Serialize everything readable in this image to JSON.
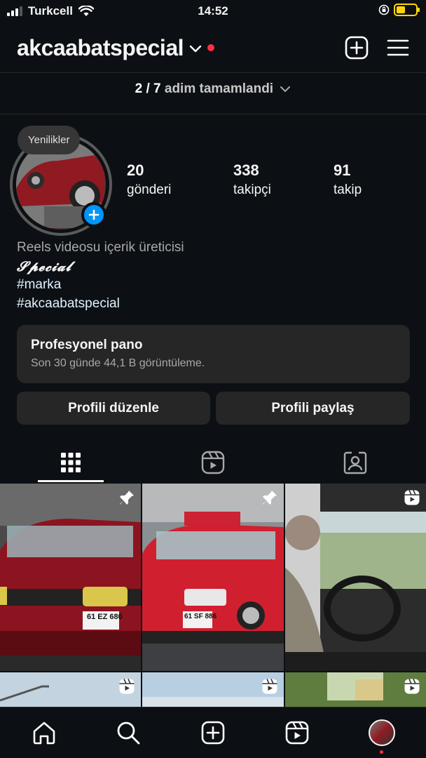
{
  "status_bar": {
    "carrier": "Turkcell",
    "time": "14:52"
  },
  "header": {
    "username": "akcaabatspecial"
  },
  "progress": {
    "count": "2 / 7",
    "label": "adim tamamlandi"
  },
  "profile": {
    "bubble": "Yenilikler",
    "stats": [
      {
        "value": "20",
        "label": "gönderi"
      },
      {
        "value": "338",
        "label": "takipçi"
      },
      {
        "value": "91",
        "label": "takip"
      }
    ],
    "bio": {
      "category": "Reels videosu içerik üreticisi",
      "name_line": "𝓢𝓹𝓮𝓬𝓲𝓪𝓵",
      "tags": [
        "#marka",
        "#akcaabatspecial"
      ]
    }
  },
  "dashboard": {
    "title": "Profesyonel pano",
    "subtitle": "Son 30 günde 44,1 B görüntüleme."
  },
  "buttons": {
    "edit": "Profili düzenle",
    "share": "Profili paylaş"
  },
  "grid": {
    "row1": [
      {
        "plate": "61 EZ 680",
        "icon": "pin-icon"
      },
      {
        "plate": "61 SF 886",
        "icon": "pin-icon"
      },
      {
        "icon": "reel-icon"
      }
    ],
    "row2": [
      {
        "icon": "reel-icon"
      },
      {
        "icon": "reel-icon"
      },
      {
        "icon": "reel-icon"
      }
    ]
  },
  "colors": {
    "background": "#0c1014",
    "surface": "#262626",
    "accent_blue": "#0095f6",
    "notification_red": "#ff3040",
    "battery_yellow": "#ffd60a"
  }
}
